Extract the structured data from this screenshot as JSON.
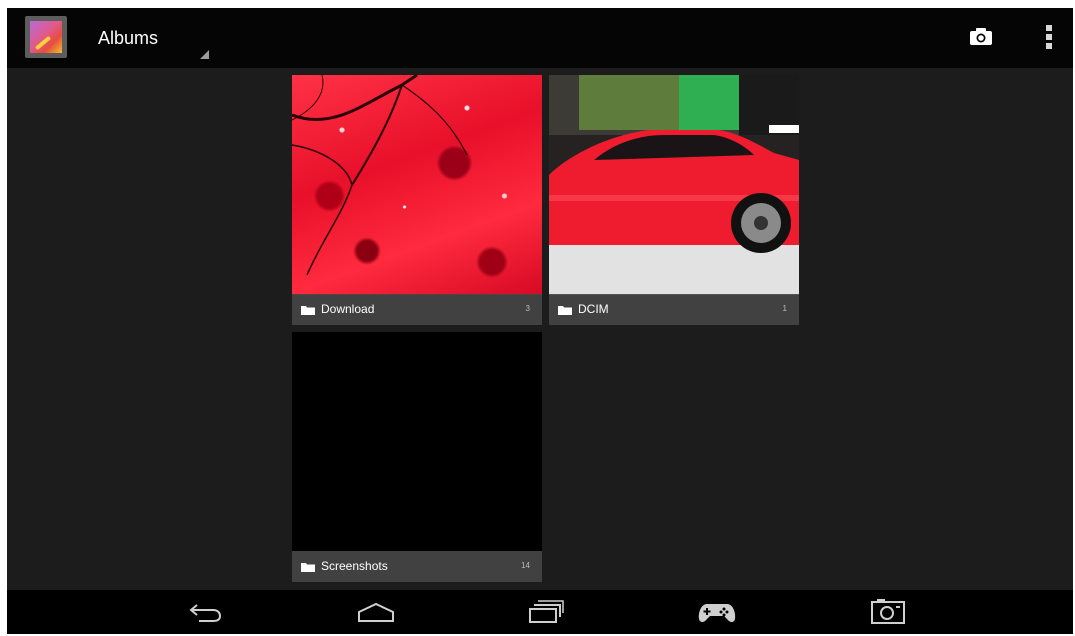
{
  "actionbar": {
    "title": "Albums",
    "app_icon": "gallery-app-icon",
    "camera_icon": "camera-icon",
    "overflow_icon": "overflow-menu-icon"
  },
  "albums": [
    {
      "name": "Download",
      "count": "3",
      "thumb": "red-autumn-leaves"
    },
    {
      "name": "DCIM",
      "count": "1",
      "thumb": "red-sports-car"
    },
    {
      "name": "Screenshots",
      "count": "14",
      "thumb": "black"
    }
  ],
  "navbar": {
    "icons": [
      "back-icon",
      "home-icon",
      "recent-apps-icon",
      "gamepad-icon",
      "screenshot-icon"
    ]
  },
  "colors": {
    "background": "#1c1c1c",
    "actionbar": "#050505",
    "caption": "#464648"
  }
}
